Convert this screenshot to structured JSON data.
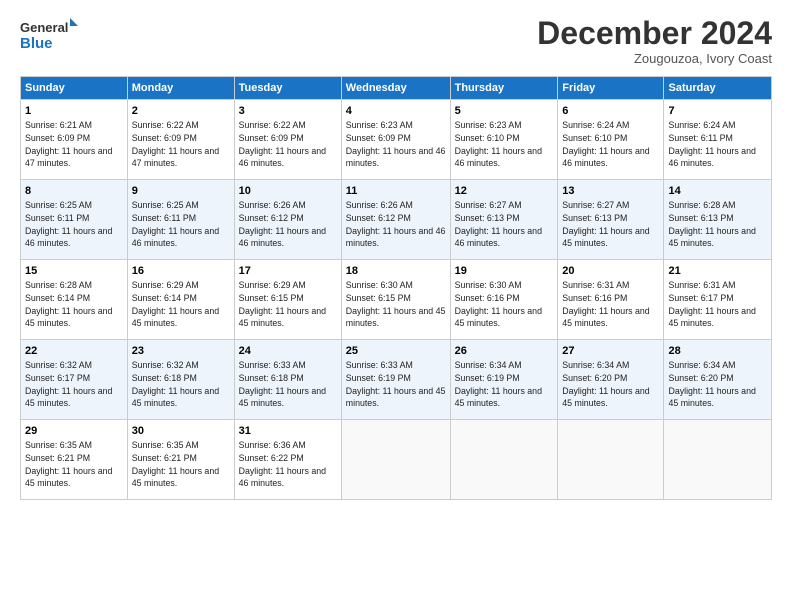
{
  "logo": {
    "line1": "General",
    "line2": "Blue"
  },
  "title": "December 2024",
  "subtitle": "Zougouzoa, Ivory Coast",
  "days_of_week": [
    "Sunday",
    "Monday",
    "Tuesday",
    "Wednesday",
    "Thursday",
    "Friday",
    "Saturday"
  ],
  "weeks": [
    [
      {
        "day": "1",
        "sunrise": "6:21 AM",
        "sunset": "6:09 PM",
        "daylight": "11 hours and 47 minutes."
      },
      {
        "day": "2",
        "sunrise": "6:22 AM",
        "sunset": "6:09 PM",
        "daylight": "11 hours and 47 minutes."
      },
      {
        "day": "3",
        "sunrise": "6:22 AM",
        "sunset": "6:09 PM",
        "daylight": "11 hours and 46 minutes."
      },
      {
        "day": "4",
        "sunrise": "6:23 AM",
        "sunset": "6:09 PM",
        "daylight": "11 hours and 46 minutes."
      },
      {
        "day": "5",
        "sunrise": "6:23 AM",
        "sunset": "6:10 PM",
        "daylight": "11 hours and 46 minutes."
      },
      {
        "day": "6",
        "sunrise": "6:24 AM",
        "sunset": "6:10 PM",
        "daylight": "11 hours and 46 minutes."
      },
      {
        "day": "7",
        "sunrise": "6:24 AM",
        "sunset": "6:11 PM",
        "daylight": "11 hours and 46 minutes."
      }
    ],
    [
      {
        "day": "8",
        "sunrise": "6:25 AM",
        "sunset": "6:11 PM",
        "daylight": "11 hours and 46 minutes."
      },
      {
        "day": "9",
        "sunrise": "6:25 AM",
        "sunset": "6:11 PM",
        "daylight": "11 hours and 46 minutes."
      },
      {
        "day": "10",
        "sunrise": "6:26 AM",
        "sunset": "6:12 PM",
        "daylight": "11 hours and 46 minutes."
      },
      {
        "day": "11",
        "sunrise": "6:26 AM",
        "sunset": "6:12 PM",
        "daylight": "11 hours and 46 minutes."
      },
      {
        "day": "12",
        "sunrise": "6:27 AM",
        "sunset": "6:13 PM",
        "daylight": "11 hours and 46 minutes."
      },
      {
        "day": "13",
        "sunrise": "6:27 AM",
        "sunset": "6:13 PM",
        "daylight": "11 hours and 45 minutes."
      },
      {
        "day": "14",
        "sunrise": "6:28 AM",
        "sunset": "6:13 PM",
        "daylight": "11 hours and 45 minutes."
      }
    ],
    [
      {
        "day": "15",
        "sunrise": "6:28 AM",
        "sunset": "6:14 PM",
        "daylight": "11 hours and 45 minutes."
      },
      {
        "day": "16",
        "sunrise": "6:29 AM",
        "sunset": "6:14 PM",
        "daylight": "11 hours and 45 minutes."
      },
      {
        "day": "17",
        "sunrise": "6:29 AM",
        "sunset": "6:15 PM",
        "daylight": "11 hours and 45 minutes."
      },
      {
        "day": "18",
        "sunrise": "6:30 AM",
        "sunset": "6:15 PM",
        "daylight": "11 hours and 45 minutes."
      },
      {
        "day": "19",
        "sunrise": "6:30 AM",
        "sunset": "6:16 PM",
        "daylight": "11 hours and 45 minutes."
      },
      {
        "day": "20",
        "sunrise": "6:31 AM",
        "sunset": "6:16 PM",
        "daylight": "11 hours and 45 minutes."
      },
      {
        "day": "21",
        "sunrise": "6:31 AM",
        "sunset": "6:17 PM",
        "daylight": "11 hours and 45 minutes."
      }
    ],
    [
      {
        "day": "22",
        "sunrise": "6:32 AM",
        "sunset": "6:17 PM",
        "daylight": "11 hours and 45 minutes."
      },
      {
        "day": "23",
        "sunrise": "6:32 AM",
        "sunset": "6:18 PM",
        "daylight": "11 hours and 45 minutes."
      },
      {
        "day": "24",
        "sunrise": "6:33 AM",
        "sunset": "6:18 PM",
        "daylight": "11 hours and 45 minutes."
      },
      {
        "day": "25",
        "sunrise": "6:33 AM",
        "sunset": "6:19 PM",
        "daylight": "11 hours and 45 minutes."
      },
      {
        "day": "26",
        "sunrise": "6:34 AM",
        "sunset": "6:19 PM",
        "daylight": "11 hours and 45 minutes."
      },
      {
        "day": "27",
        "sunrise": "6:34 AM",
        "sunset": "6:20 PM",
        "daylight": "11 hours and 45 minutes."
      },
      {
        "day": "28",
        "sunrise": "6:34 AM",
        "sunset": "6:20 PM",
        "daylight": "11 hours and 45 minutes."
      }
    ],
    [
      {
        "day": "29",
        "sunrise": "6:35 AM",
        "sunset": "6:21 PM",
        "daylight": "11 hours and 45 minutes."
      },
      {
        "day": "30",
        "sunrise": "6:35 AM",
        "sunset": "6:21 PM",
        "daylight": "11 hours and 45 minutes."
      },
      {
        "day": "31",
        "sunrise": "6:36 AM",
        "sunset": "6:22 PM",
        "daylight": "11 hours and 46 minutes."
      },
      null,
      null,
      null,
      null
    ]
  ]
}
